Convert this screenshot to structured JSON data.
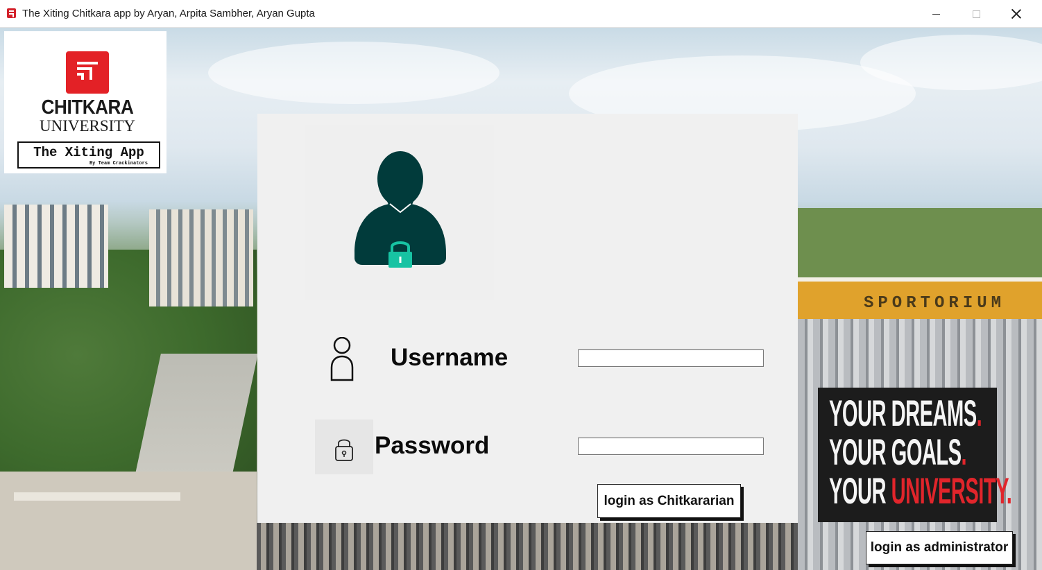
{
  "window": {
    "title": "The Xiting Chitkara app by Aryan, Arpita Sambher, Aryan Gupta",
    "minimize_icon": "minimize-icon",
    "maximize_icon": "maximize-icon",
    "close_icon": "close-icon"
  },
  "logo": {
    "name_line1": "CHITKARA",
    "name_line2": "UNIVERSITY",
    "app_title": "The Xiting App",
    "app_subtitle": "By Team Crackinators",
    "brand_color": "#e32126"
  },
  "background": {
    "building_sign": "SPORTORIUM"
  },
  "login": {
    "username_label": "Username",
    "username_value": "",
    "password_label": "Password",
    "password_value": "",
    "user_button": "login as Chitkararian",
    "admin_button": "login as administrator",
    "avatar_icon": "user-lock-icon",
    "lock_color": "#17c3a3",
    "avatar_color": "#013b3b"
  },
  "banner": {
    "line1": "YOUR DREAMS",
    "line1_dot": ".",
    "line2": "YOUR GOALS",
    "line2_dot": ".",
    "line3_prefix": "YOUR ",
    "line3_highlight": "UNIVERSITY",
    "line3_dot": ".",
    "accent_color": "#e1252b"
  }
}
